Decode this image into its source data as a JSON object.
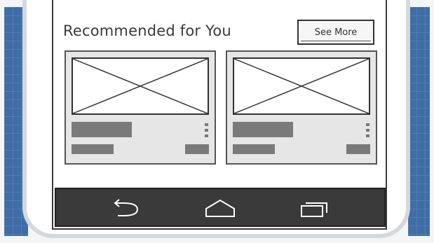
{
  "recommended": {
    "title": "Recommended for You",
    "see_more_label": "See More"
  },
  "cards": [
    {
      "id": "card-1"
    },
    {
      "id": "card-2"
    }
  ],
  "navbar": {
    "icons": [
      "back-icon",
      "home-icon",
      "recent-apps-icon"
    ]
  },
  "colors": {
    "blueprint": "#3f6da6",
    "navbar": "#3a3a3a",
    "card": "#e6e6e6",
    "placeholder_bar": "#7a7a7a"
  }
}
